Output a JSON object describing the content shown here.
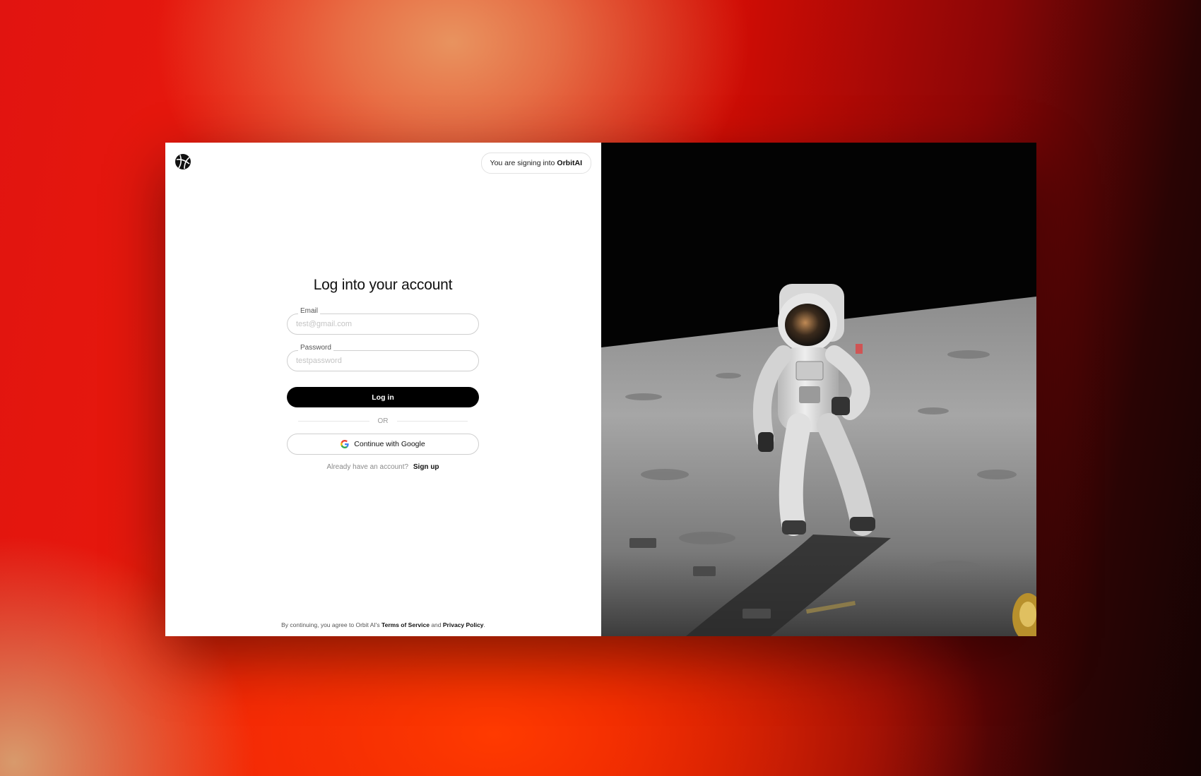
{
  "header": {
    "signing_prefix": "You are signing into",
    "signing_brand": "OrbitAI",
    "logo_icon": "orbit-logo-icon"
  },
  "login": {
    "title": "Log into your account",
    "email_label": "Email",
    "email_placeholder": "test@gmail.com",
    "email_value": "",
    "password_label": "Password",
    "password_placeholder": "testpassword",
    "password_value": "",
    "login_button": "Log in",
    "divider": "OR",
    "google_button": "Continue with Google",
    "google_icon": "google-icon",
    "account_prompt": "Already have an account?",
    "signup_link": "Sign up"
  },
  "footer": {
    "prefix": "By continuing, you agree to Orbit AI's",
    "terms": "Terms of Service",
    "and": "and",
    "privacy": "Privacy Policy",
    "period": "."
  },
  "colors": {
    "button_bg": "#000000",
    "panel_bg": "#ffffff",
    "background_accent": "#e11410"
  },
  "hero": {
    "image_subject": "astronaut-on-moon-photo"
  }
}
